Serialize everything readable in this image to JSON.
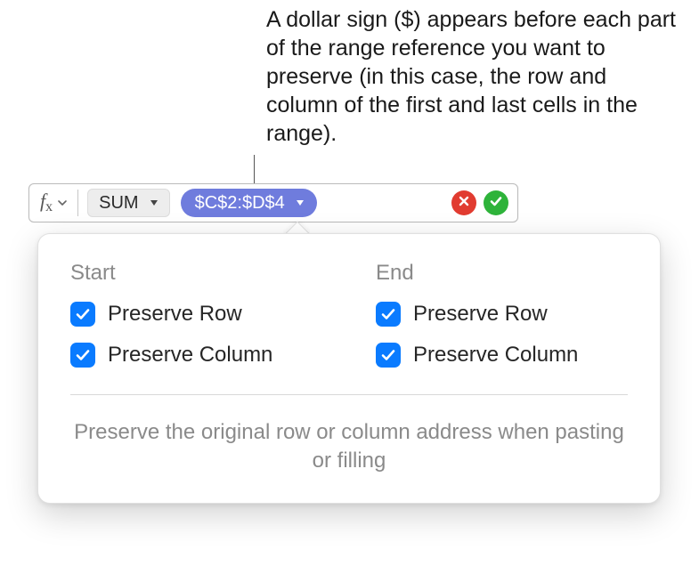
{
  "callout": "A dollar sign ($) appears before each part of the range reference you want to preserve (in this case, the row and column of the first and last cells in the range).",
  "formula_bar": {
    "fx_label_main": "f",
    "fx_label_sub": "x",
    "function_name": "SUM",
    "range_reference": "$C$2:$D$4"
  },
  "popover": {
    "start_title": "Start",
    "end_title": "End",
    "start": {
      "preserve_row": {
        "label": "Preserve Row",
        "checked": true
      },
      "preserve_col": {
        "label": "Preserve Column",
        "checked": true
      }
    },
    "end": {
      "preserve_row": {
        "label": "Preserve Row",
        "checked": true
      },
      "preserve_col": {
        "label": "Preserve Column",
        "checked": true
      }
    },
    "description": "Preserve the original row or column address when pasting or filling"
  }
}
